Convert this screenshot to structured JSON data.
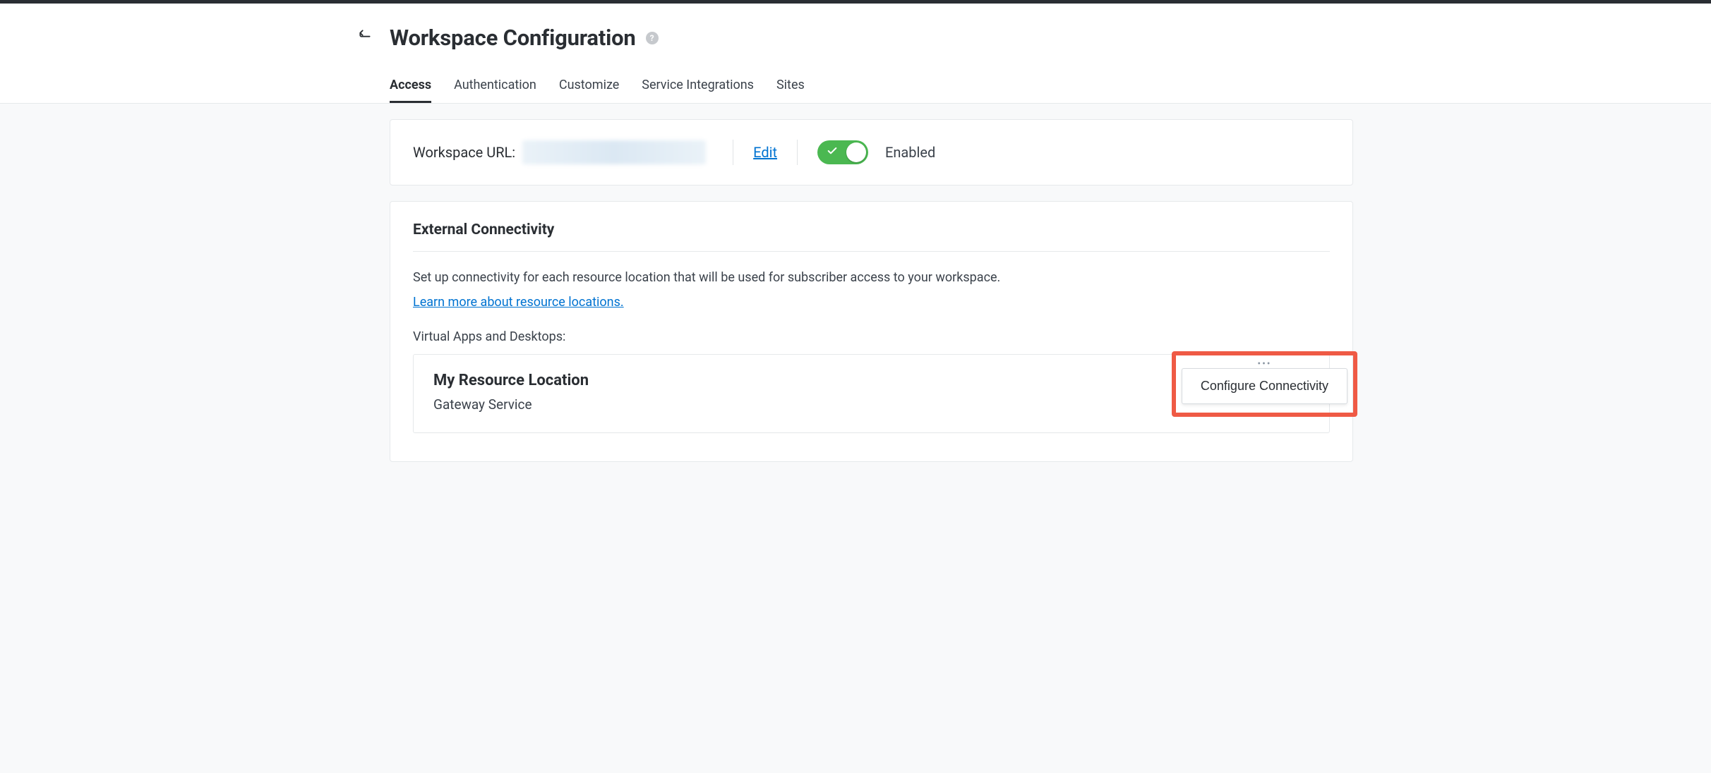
{
  "header": {
    "title": "Workspace Configuration"
  },
  "tabs": {
    "items": [
      {
        "label": "Access",
        "active": true
      },
      {
        "label": "Authentication",
        "active": false
      },
      {
        "label": "Customize",
        "active": false
      },
      {
        "label": "Service Integrations",
        "active": false
      },
      {
        "label": "Sites",
        "active": false
      }
    ]
  },
  "workspace_url": {
    "label": "Workspace URL:",
    "edit_label": "Edit",
    "toggle_state": "Enabled"
  },
  "external": {
    "title": "External Connectivity",
    "description": "Set up connectivity for each resource location that will be used for subscriber access to your workspace.",
    "learn_more": "Learn more about resource locations.",
    "vad_label": "Virtual Apps and Desktops:",
    "resource": {
      "name": "My Resource Location",
      "gateway": "Gateway Service",
      "menu_label": "Configure Connectivity"
    }
  }
}
